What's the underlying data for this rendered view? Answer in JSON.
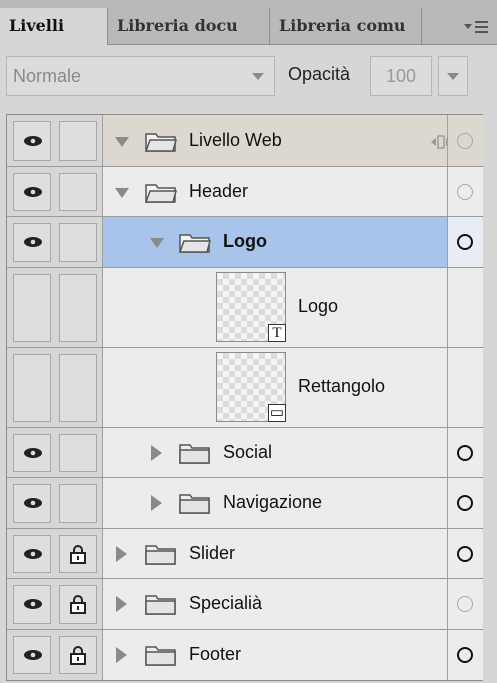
{
  "tabs": [
    {
      "label": "Livelli",
      "active": true
    },
    {
      "label": "Libreria docu",
      "active": false
    },
    {
      "label": "Libreria comu",
      "active": false
    }
  ],
  "controls": {
    "blend_mode": "Normale",
    "opacity_label": "Opacità",
    "opacity_value": "100"
  },
  "layers": [
    {
      "name": "Livello Web",
      "type": "folder",
      "expanded": true,
      "visible": true,
      "locked": false
    },
    {
      "name": "Header",
      "type": "folder",
      "expanded": true,
      "visible": true,
      "locked": false
    },
    {
      "name": "Logo",
      "type": "folder",
      "expanded": true,
      "visible": true,
      "locked": false,
      "selected": true
    },
    {
      "name": "Logo",
      "type": "text-layer",
      "badge": "T"
    },
    {
      "name": "Rettangolo",
      "type": "shape-layer",
      "badge": "▭"
    },
    {
      "name": "Social",
      "type": "folder",
      "expanded": false,
      "visible": true,
      "locked": false
    },
    {
      "name": "Navigazione",
      "type": "folder",
      "expanded": false,
      "visible": true,
      "locked": false
    },
    {
      "name": "Slider",
      "type": "folder",
      "expanded": false,
      "visible": true,
      "locked": true
    },
    {
      "name": "Specialià",
      "type": "folder",
      "expanded": false,
      "visible": true,
      "locked": true
    },
    {
      "name": "Footer",
      "type": "folder",
      "expanded": false,
      "visible": true,
      "locked": true
    }
  ],
  "colors": {
    "selection": "#a9c4ea",
    "group_row": "#dcd8d0"
  },
  "icons": [
    "eye-icon",
    "lock-icon",
    "folder-icon",
    "expand-triangle-icon",
    "collapse-triangle-icon",
    "panel-menu-icon",
    "anchor-icon",
    "visibility-circle-icon"
  ]
}
